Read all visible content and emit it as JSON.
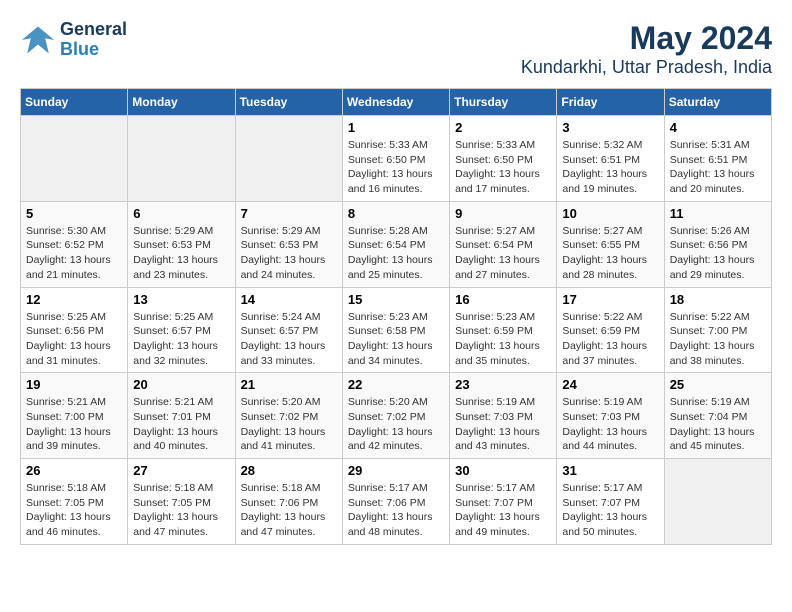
{
  "logo": {
    "line1": "General",
    "line2": "Blue"
  },
  "title": "May 2024",
  "subtitle": "Kundarkhi, Uttar Pradesh, India",
  "days_of_week": [
    "Sunday",
    "Monday",
    "Tuesday",
    "Wednesday",
    "Thursday",
    "Friday",
    "Saturday"
  ],
  "weeks": [
    [
      {
        "day": "",
        "info": ""
      },
      {
        "day": "",
        "info": ""
      },
      {
        "day": "",
        "info": ""
      },
      {
        "day": "1",
        "info": "Sunrise: 5:33 AM\nSunset: 6:50 PM\nDaylight: 13 hours\nand 16 minutes."
      },
      {
        "day": "2",
        "info": "Sunrise: 5:33 AM\nSunset: 6:50 PM\nDaylight: 13 hours\nand 17 minutes."
      },
      {
        "day": "3",
        "info": "Sunrise: 5:32 AM\nSunset: 6:51 PM\nDaylight: 13 hours\nand 19 minutes."
      },
      {
        "day": "4",
        "info": "Sunrise: 5:31 AM\nSunset: 6:51 PM\nDaylight: 13 hours\nand 20 minutes."
      }
    ],
    [
      {
        "day": "5",
        "info": "Sunrise: 5:30 AM\nSunset: 6:52 PM\nDaylight: 13 hours\nand 21 minutes."
      },
      {
        "day": "6",
        "info": "Sunrise: 5:29 AM\nSunset: 6:53 PM\nDaylight: 13 hours\nand 23 minutes."
      },
      {
        "day": "7",
        "info": "Sunrise: 5:29 AM\nSunset: 6:53 PM\nDaylight: 13 hours\nand 24 minutes."
      },
      {
        "day": "8",
        "info": "Sunrise: 5:28 AM\nSunset: 6:54 PM\nDaylight: 13 hours\nand 25 minutes."
      },
      {
        "day": "9",
        "info": "Sunrise: 5:27 AM\nSunset: 6:54 PM\nDaylight: 13 hours\nand 27 minutes."
      },
      {
        "day": "10",
        "info": "Sunrise: 5:27 AM\nSunset: 6:55 PM\nDaylight: 13 hours\nand 28 minutes."
      },
      {
        "day": "11",
        "info": "Sunrise: 5:26 AM\nSunset: 6:56 PM\nDaylight: 13 hours\nand 29 minutes."
      }
    ],
    [
      {
        "day": "12",
        "info": "Sunrise: 5:25 AM\nSunset: 6:56 PM\nDaylight: 13 hours\nand 31 minutes."
      },
      {
        "day": "13",
        "info": "Sunrise: 5:25 AM\nSunset: 6:57 PM\nDaylight: 13 hours\nand 32 minutes."
      },
      {
        "day": "14",
        "info": "Sunrise: 5:24 AM\nSunset: 6:57 PM\nDaylight: 13 hours\nand 33 minutes."
      },
      {
        "day": "15",
        "info": "Sunrise: 5:23 AM\nSunset: 6:58 PM\nDaylight: 13 hours\nand 34 minutes."
      },
      {
        "day": "16",
        "info": "Sunrise: 5:23 AM\nSunset: 6:59 PM\nDaylight: 13 hours\nand 35 minutes."
      },
      {
        "day": "17",
        "info": "Sunrise: 5:22 AM\nSunset: 6:59 PM\nDaylight: 13 hours\nand 37 minutes."
      },
      {
        "day": "18",
        "info": "Sunrise: 5:22 AM\nSunset: 7:00 PM\nDaylight: 13 hours\nand 38 minutes."
      }
    ],
    [
      {
        "day": "19",
        "info": "Sunrise: 5:21 AM\nSunset: 7:00 PM\nDaylight: 13 hours\nand 39 minutes."
      },
      {
        "day": "20",
        "info": "Sunrise: 5:21 AM\nSunset: 7:01 PM\nDaylight: 13 hours\nand 40 minutes."
      },
      {
        "day": "21",
        "info": "Sunrise: 5:20 AM\nSunset: 7:02 PM\nDaylight: 13 hours\nand 41 minutes."
      },
      {
        "day": "22",
        "info": "Sunrise: 5:20 AM\nSunset: 7:02 PM\nDaylight: 13 hours\nand 42 minutes."
      },
      {
        "day": "23",
        "info": "Sunrise: 5:19 AM\nSunset: 7:03 PM\nDaylight: 13 hours\nand 43 minutes."
      },
      {
        "day": "24",
        "info": "Sunrise: 5:19 AM\nSunset: 7:03 PM\nDaylight: 13 hours\nand 44 minutes."
      },
      {
        "day": "25",
        "info": "Sunrise: 5:19 AM\nSunset: 7:04 PM\nDaylight: 13 hours\nand 45 minutes."
      }
    ],
    [
      {
        "day": "26",
        "info": "Sunrise: 5:18 AM\nSunset: 7:05 PM\nDaylight: 13 hours\nand 46 minutes."
      },
      {
        "day": "27",
        "info": "Sunrise: 5:18 AM\nSunset: 7:05 PM\nDaylight: 13 hours\nand 47 minutes."
      },
      {
        "day": "28",
        "info": "Sunrise: 5:18 AM\nSunset: 7:06 PM\nDaylight: 13 hours\nand 47 minutes."
      },
      {
        "day": "29",
        "info": "Sunrise: 5:17 AM\nSunset: 7:06 PM\nDaylight: 13 hours\nand 48 minutes."
      },
      {
        "day": "30",
        "info": "Sunrise: 5:17 AM\nSunset: 7:07 PM\nDaylight: 13 hours\nand 49 minutes."
      },
      {
        "day": "31",
        "info": "Sunrise: 5:17 AM\nSunset: 7:07 PM\nDaylight: 13 hours\nand 50 minutes."
      },
      {
        "day": "",
        "info": ""
      }
    ]
  ]
}
